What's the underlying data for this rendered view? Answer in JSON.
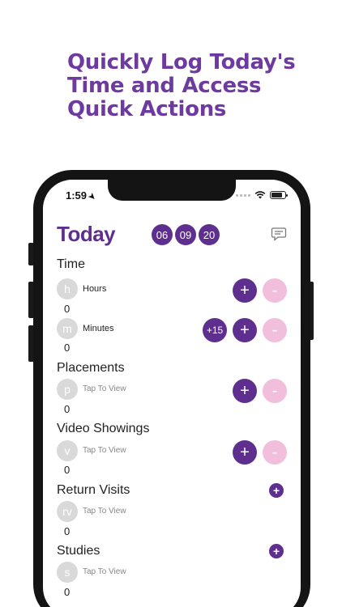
{
  "headline": [
    "Quickly Log Today's",
    "Time and Access",
    "Quick Actions"
  ],
  "status_bar": {
    "time": "1:59",
    "location_arrow": "➤"
  },
  "header": {
    "title": "Today",
    "date": [
      "06",
      "09",
      "20"
    ],
    "chat_icon": "chat-bubble-icon"
  },
  "sections": {
    "time": {
      "title": "Time",
      "hours": {
        "avatar": "h",
        "label": "Hours",
        "value": "0"
      },
      "minutes": {
        "avatar": "m",
        "label": "Minutes",
        "value": "0",
        "quick_add": "+15"
      }
    },
    "placements": {
      "title": "Placements",
      "avatar": "p",
      "label": "Tap To View",
      "value": "0"
    },
    "video_showings": {
      "title": "Video Showings",
      "avatar": "v",
      "label": "Tap To View",
      "value": "0"
    },
    "return_visits": {
      "title": "Return Visits",
      "avatar": "rv",
      "label": "Tap To View",
      "value": "0"
    },
    "studies": {
      "title": "Studies",
      "avatar": "s",
      "label": "Tap To View",
      "value": "0"
    }
  },
  "buttons": {
    "plus": "+",
    "minus": "-"
  },
  "colors": {
    "brand_purple": "#5f2f8f",
    "headline_purple": "#6f3aa0",
    "minus_pink": "#f1bfdc",
    "avatar_gray": "#d9d9d9"
  }
}
